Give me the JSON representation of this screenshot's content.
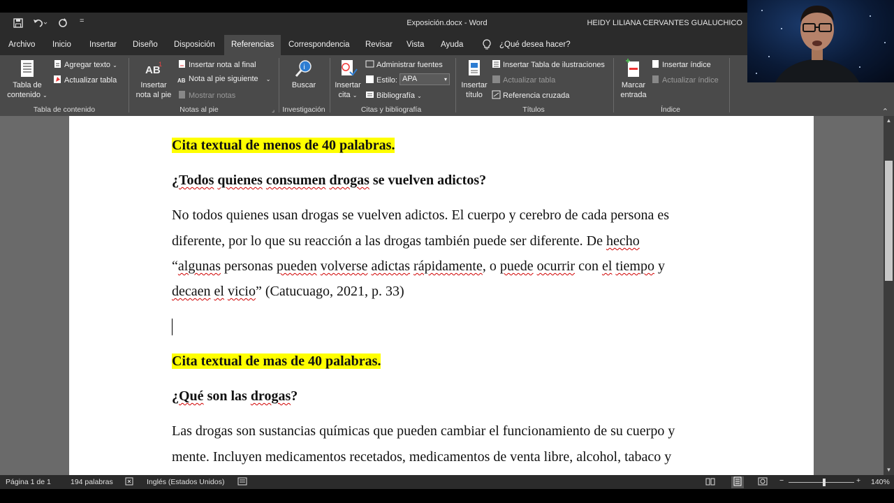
{
  "window": {
    "title": "Exposición.docx  -  Word",
    "user": "HEIDY LILIANA CERVANTES GUALUCHICO",
    "qat_customize": "="
  },
  "tabs": [
    {
      "label": "Archivo"
    },
    {
      "label": "Inicio"
    },
    {
      "label": "Insertar"
    },
    {
      "label": "Diseño"
    },
    {
      "label": "Disposición"
    },
    {
      "label": "Referencias",
      "active": true
    },
    {
      "label": "Correspondencia"
    },
    {
      "label": "Revisar"
    },
    {
      "label": "Vista"
    },
    {
      "label": "Ayuda"
    },
    {
      "label": "¿Qué desea hacer?"
    }
  ],
  "ribbon": {
    "toc": {
      "btn_line1": "Tabla de",
      "btn_line2": "contenido",
      "add_text": "Agregar texto",
      "update_table": "Actualizar tabla",
      "group": "Tabla de contenido"
    },
    "footnotes": {
      "btn_line1": "Insertar",
      "btn_line2": "nota al pie",
      "insert_endnote": "Insertar nota al final",
      "next_footnote": "Nota al pie siguiente",
      "show_notes": "Mostrar notas",
      "group": "Notas al pie"
    },
    "research": {
      "btn": "Buscar",
      "group": "Investigación"
    },
    "citations": {
      "btn_line1": "Insertar",
      "btn_line2": "cita",
      "manage_sources": "Administrar fuentes",
      "style_label": "Estilo:",
      "style_value": "APA",
      "bibliography": "Bibliografía",
      "group": "Citas y bibliografía"
    },
    "captions": {
      "btn_line1": "Insertar",
      "btn_line2": "título",
      "insert_table_figures": "Insertar Tabla de ilustraciones",
      "update_table": "Actualizar tabla",
      "cross_reference": "Referencia cruzada",
      "group": "Títulos"
    },
    "index": {
      "btn_line1": "Marcar",
      "btn_line2": "entrada",
      "insert_index": "Insertar índice",
      "update_index": "Actualizar índice",
      "group": "Índice"
    }
  },
  "document": {
    "h1": "Cita textual de menos de 40 palabras.",
    "q1": [
      "¿",
      "Todos",
      " ",
      "quienes",
      " ",
      "consumen",
      " ",
      "drogas",
      " se vuelven adictos?"
    ],
    "para1_l1": "No todos quienes usan drogas se vuelven adictos. El cuerpo y cerebro de cada persona es",
    "para1_l2": [
      "diferente, por lo que su reacción a las drogas también puede ser diferente. De ",
      "hecho"
    ],
    "para1_l3": [
      "“",
      "algunas",
      " personas ",
      "pueden",
      " ",
      "volverse",
      " ",
      "adictas",
      " ",
      "rápidamente",
      ", o ",
      "puede",
      " ",
      "ocurrir",
      " con ",
      "el",
      " ",
      "tiempo",
      " y"
    ],
    "para1_l4": [
      "decaen",
      " ",
      "el",
      " ",
      "vicio",
      "” (Catucuago, 2021, p. 33)"
    ],
    "h2": "Cita textual de mas de 40 palabras.",
    "q2": [
      "¿",
      "Qué",
      " son las ",
      "drogas",
      "?"
    ],
    "para2_l1": "Las drogas son sustancias químicas que pueden cambiar el funcionamiento de su cuerpo y",
    "para2_l2": "mente. Incluyen medicamentos recetados, medicamentos de venta libre, alcohol, tabaco y"
  },
  "status": {
    "page": "Página 1 de 1",
    "words": "194 palabras",
    "language": "Inglés (Estados Unidos)",
    "zoom": "140%",
    "zoom_minus": "−",
    "zoom_plus": "+"
  },
  "colors": {
    "highlight": "#ffff00",
    "spell_squiggle": "#d00000",
    "ribbon_bg": "#4a4a4a",
    "titlebar_bg": "#2b2b2b"
  }
}
